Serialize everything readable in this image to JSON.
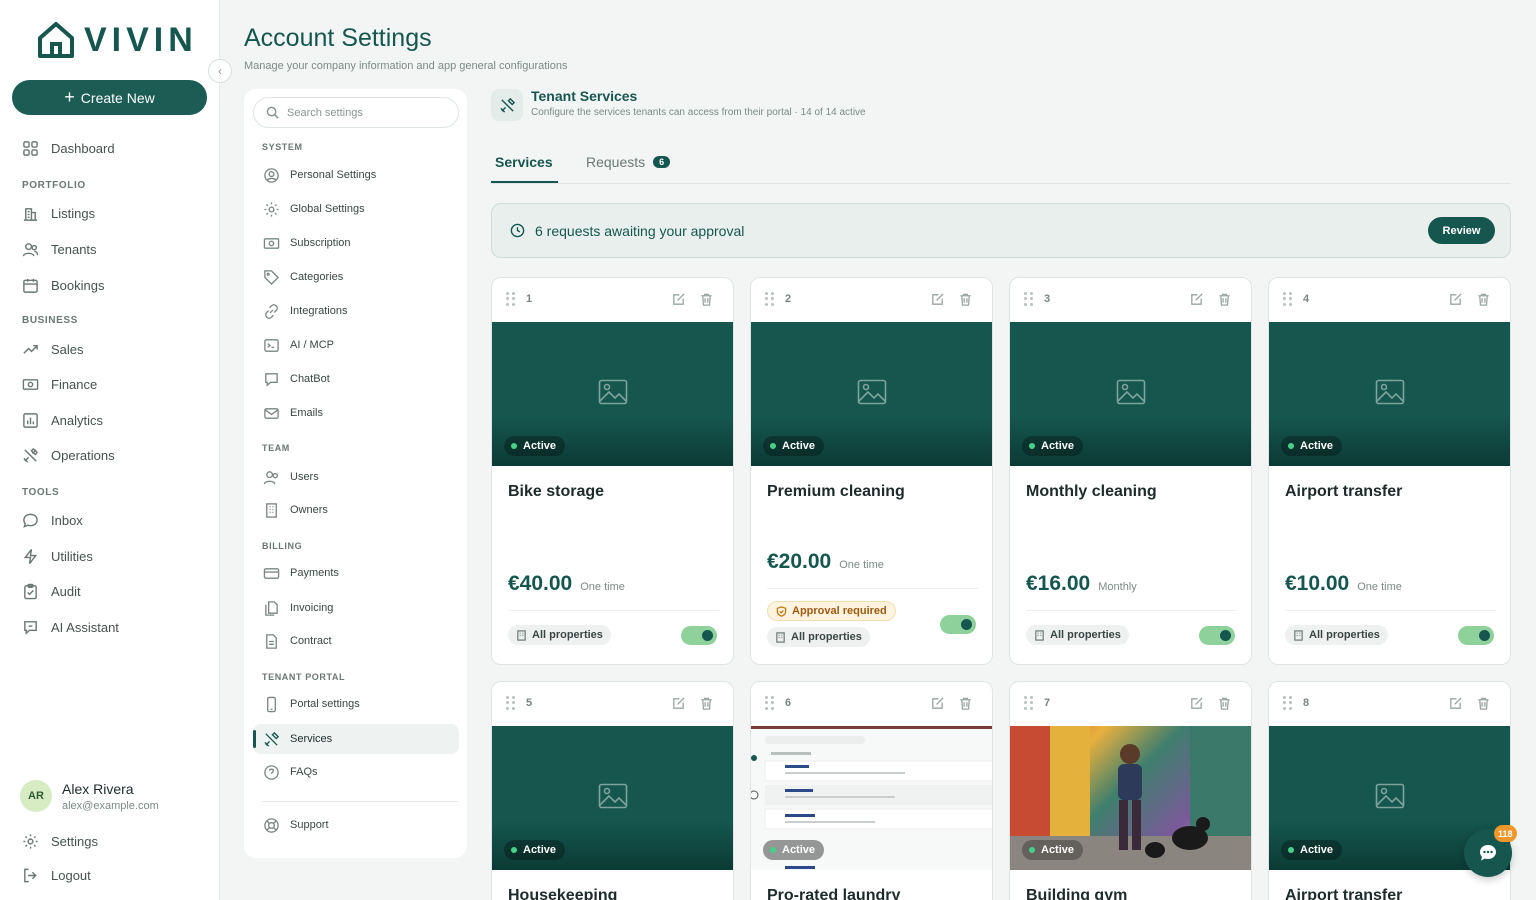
{
  "brand": {
    "name": "VIVIN",
    "accent": "#15574f"
  },
  "sidebar": {
    "create_label": "Create New",
    "items": [
      {
        "label": "Dashboard",
        "icon": "grid-icon"
      },
      {
        "section": "PORTFOLIO"
      },
      {
        "label": "Listings",
        "icon": "building-icon"
      },
      {
        "label": "Tenants",
        "icon": "users-icon"
      },
      {
        "label": "Bookings",
        "icon": "calendar-icon"
      },
      {
        "section": "BUSINESS"
      },
      {
        "label": "Sales",
        "icon": "trend-icon"
      },
      {
        "label": "Finance",
        "icon": "money-icon"
      },
      {
        "label": "Analytics",
        "icon": "chart-icon"
      },
      {
        "label": "Operations",
        "icon": "tools-icon"
      },
      {
        "section": "TOOLS"
      },
      {
        "label": "Inbox",
        "icon": "chat-icon"
      },
      {
        "label": "Utilities",
        "icon": "bolt-icon"
      },
      {
        "label": "Audit",
        "icon": "clipboard-icon"
      },
      {
        "label": "AI Assistant",
        "icon": "ai-chat-icon"
      }
    ],
    "user": {
      "initials": "AR",
      "name": "Alex Rivera",
      "email": "alex@example.com"
    },
    "settings_label": "Settings",
    "logout_label": "Logout"
  },
  "header": {
    "title": "Account Settings",
    "subtitle": "Manage your company information and app general configurations"
  },
  "settings_nav": {
    "search_placeholder": "Search settings",
    "sections": {
      "system": "SYSTEM",
      "team": "TEAM",
      "billing": "BILLING",
      "tenant_portal": "TENANT PORTAL"
    },
    "items": {
      "personal": "Personal Settings",
      "global": "Global Settings",
      "subscription": "Subscription",
      "categories": "Categories",
      "integrations": "Integrations",
      "ai_mcp": "AI / MCP",
      "chatbot": "ChatBot",
      "emails": "Emails",
      "users": "Users",
      "owners": "Owners",
      "payments": "Payments",
      "invoicing": "Invoicing",
      "contract": "Contract",
      "portal_settings": "Portal settings",
      "services": "Services",
      "faqs": "FAQs",
      "support": "Support"
    }
  },
  "section": {
    "title": "Tenant Services",
    "subtitle": "Configure the services tenants can access from their portal · 14 of 14 active"
  },
  "tabs": [
    {
      "label": "Services",
      "active": true
    },
    {
      "label": "Requests",
      "badge": "6"
    }
  ],
  "banner": {
    "text": "6 requests awaiting your approval",
    "button": "Review"
  },
  "cards": [
    {
      "num": "1",
      "status": "Active",
      "name": "Bike storage",
      "price": "€40.00",
      "unit": "One time",
      "scope": "All properties",
      "enabled": true
    },
    {
      "num": "2",
      "status": "Active",
      "name": "Premium cleaning",
      "price": "€20.00",
      "unit": "One time",
      "approval": "Approval required",
      "scope": "All properties",
      "enabled": true
    },
    {
      "num": "3",
      "status": "Active",
      "name": "Monthly cleaning",
      "price": "€16.00",
      "unit": "Monthly",
      "scope": "All properties",
      "enabled": true
    },
    {
      "num": "4",
      "status": "Active",
      "name": "Airport transfer",
      "price": "€10.00",
      "unit": "One time",
      "scope": "All properties",
      "enabled": true
    },
    {
      "num": "5",
      "status": "Active",
      "name": "Housekeeping"
    },
    {
      "num": "6",
      "status": "Active",
      "name": "Pro-rated laundry"
    },
    {
      "num": "7",
      "status": "Active",
      "name": "Building gym"
    },
    {
      "num": "8",
      "status": "Active",
      "name": "Airport transfer"
    }
  ],
  "chat": {
    "badge": "118"
  }
}
